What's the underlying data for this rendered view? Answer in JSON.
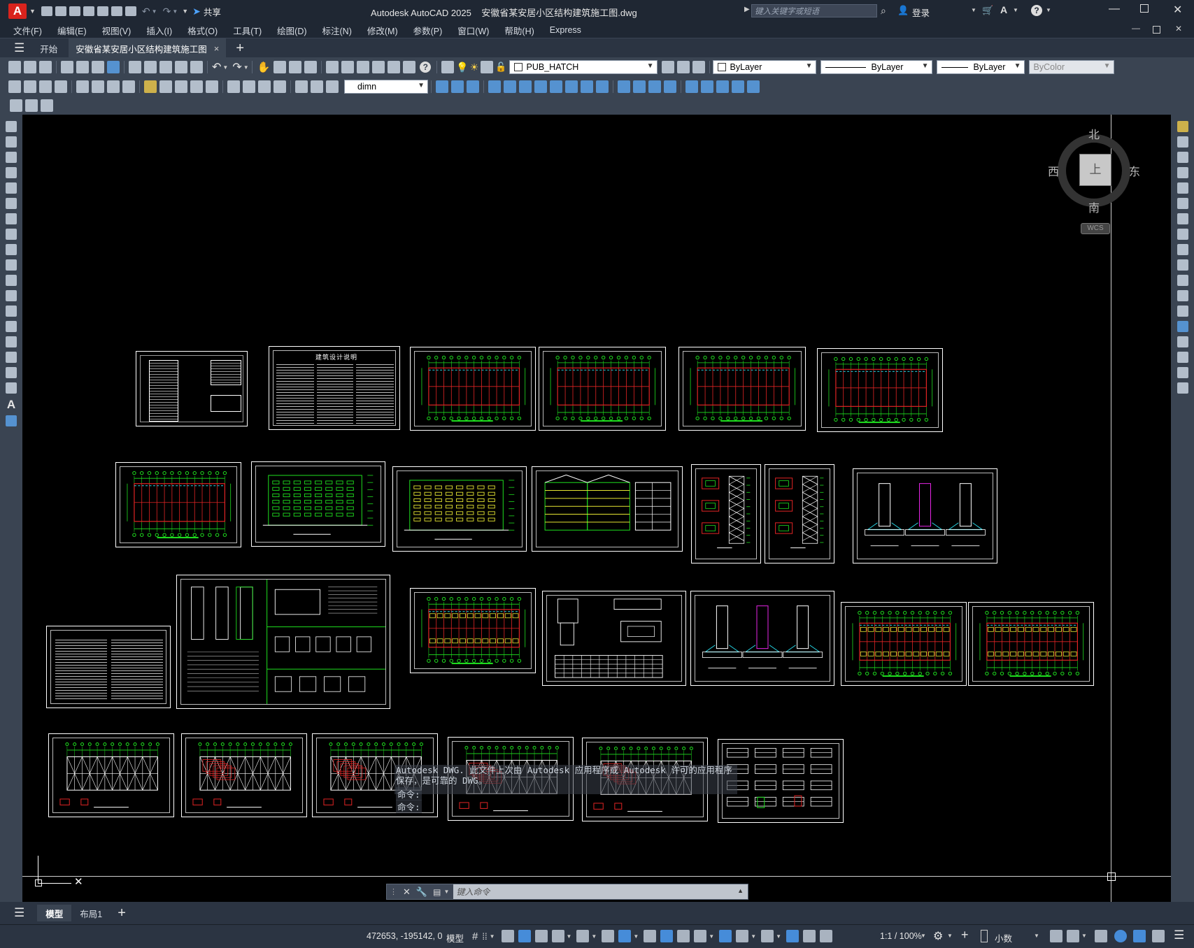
{
  "title_bar": {
    "app_logo": "A",
    "share_label": "共享",
    "window_title": "Autodesk AutoCAD 2025    安徽省某安居小区结构建筑施工图.dwg",
    "search_placeholder": "键入关键字或短语",
    "login_label": "登录"
  },
  "menu": {
    "items": [
      "文件(F)",
      "编辑(E)",
      "视图(V)",
      "插入(I)",
      "格式(O)",
      "工具(T)",
      "绘图(D)",
      "标注(N)",
      "修改(M)",
      "参数(P)",
      "窗口(W)",
      "帮助(H)",
      "Express"
    ]
  },
  "doc_tabs": {
    "start_label": "开始",
    "active_label": "安徽省某安居小区结构建筑施工图",
    "close_glyph": "×",
    "new_tab_glyph": "+"
  },
  "toolbar": {
    "layer_name": "PUB_HATCH",
    "color_value": "ByLayer",
    "linetype_value": "ByLayer",
    "lineweight_value": "ByLayer",
    "plotstyle_value": "ByColor",
    "dimstyle_value": "dimn"
  },
  "viewcube": {
    "north": "北",
    "south": "南",
    "east": "东",
    "west": "西",
    "face": "上",
    "ucs_label": "WCS"
  },
  "command": {
    "history_line1": "Autodesk DWG.  此文件上次由 Autodesk 应用程序或 Autodesk 许可的应用程序保存，是可靠的 DWG。",
    "history_line2": "命令:",
    "history_line3": "命令:",
    "input_placeholder": "键入命令"
  },
  "layout_tabs": {
    "model_label": "模型",
    "layout1_label": "布局1",
    "add_glyph": "+"
  },
  "status": {
    "coordinates": "472653, -195142, 0",
    "space_label": "模型",
    "scale": "1:1 / 100%",
    "units": "小数"
  },
  "drawing_sheets": {
    "sheet_03_title": "建筑设计说明"
  },
  "colors": {
    "background": "#000000",
    "ui_dark": "#1f2733",
    "ui_panel": "#3a4452",
    "drawing_green": "#1fe01f",
    "drawing_red": "#e02424",
    "drawing_yellow": "#e6e632",
    "drawing_cyan": "#26d6e6",
    "drawing_magenta": "#e626e6"
  }
}
